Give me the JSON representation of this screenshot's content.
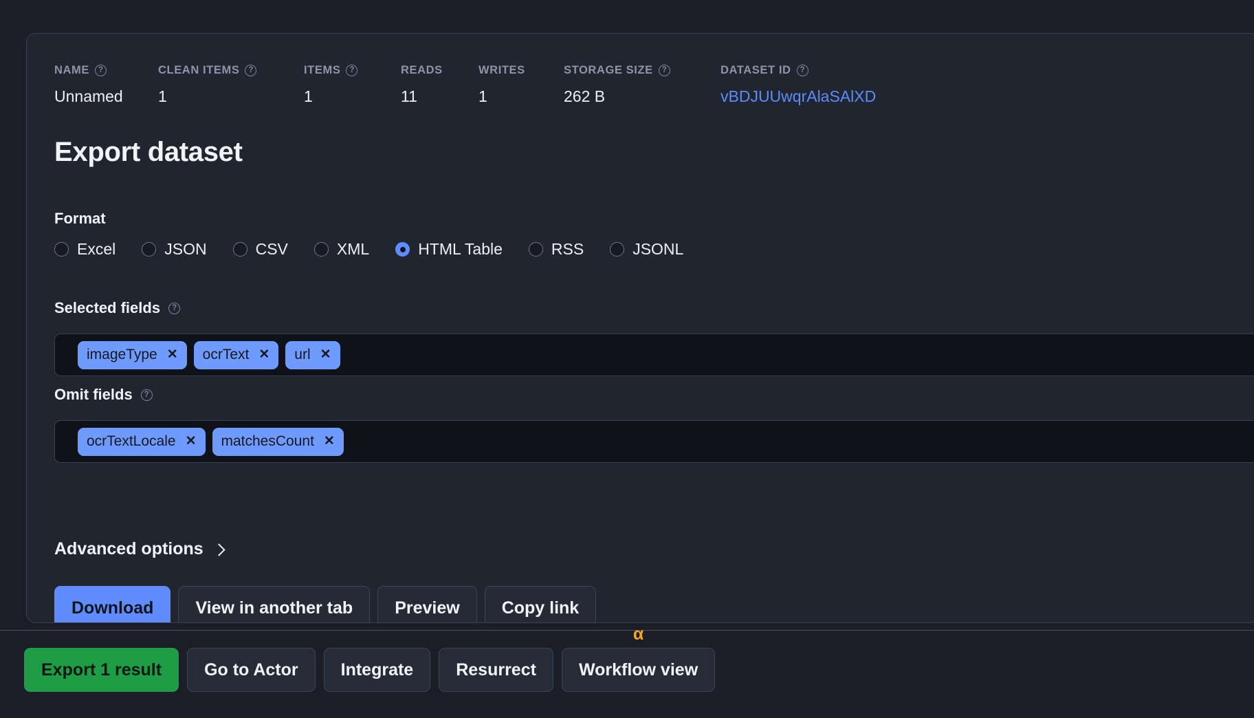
{
  "stats": [
    {
      "label": "NAME",
      "value": "Unnamed",
      "help": true,
      "width_class": "w-name",
      "link": false
    },
    {
      "label": "CLEAN ITEMS",
      "value": "1",
      "help": true,
      "width_class": "w-clean",
      "link": false
    },
    {
      "label": "ITEMS",
      "value": "1",
      "help": true,
      "width_class": "w-items",
      "link": false
    },
    {
      "label": "READS",
      "value": "11",
      "help": false,
      "width_class": "w-reads",
      "link": false
    },
    {
      "label": "WRITES",
      "value": "1",
      "help": false,
      "width_class": "w-writes",
      "link": false
    },
    {
      "label": "STORAGE SIZE",
      "value": "262 B",
      "help": true,
      "width_class": "w-size",
      "link": false
    },
    {
      "label": "DATASET ID",
      "value": "vBDJUUwqrAlaSAlXD",
      "help": true,
      "width_class": "w-id",
      "link": true
    }
  ],
  "page": {
    "title": "Export dataset"
  },
  "format": {
    "label": "Format",
    "options": [
      {
        "label": "Excel",
        "selected": false
      },
      {
        "label": "JSON",
        "selected": false
      },
      {
        "label": "CSV",
        "selected": false
      },
      {
        "label": "XML",
        "selected": false
      },
      {
        "label": "HTML Table",
        "selected": true
      },
      {
        "label": "RSS",
        "selected": false
      },
      {
        "label": "JSONL",
        "selected": false
      }
    ],
    "selected_value": "HTML Table"
  },
  "selected_fields": {
    "label": "Selected fields",
    "tokens": [
      "imageType",
      "ocrText",
      "url"
    ],
    "remove_glyph": "✕"
  },
  "omit_fields": {
    "label": "Omit fields",
    "tokens": [
      "ocrTextLocale",
      "matchesCount"
    ],
    "remove_glyph": "✕"
  },
  "advanced": {
    "label": "Advanced options",
    "expanded": false
  },
  "actions": [
    {
      "label": "Download",
      "style": "primary"
    },
    {
      "label": "View in another tab",
      "style": "ghost"
    },
    {
      "label": "Preview",
      "style": "ghost"
    },
    {
      "label": "Copy link",
      "style": "ghost"
    }
  ],
  "bottom_bar": {
    "buttons": [
      {
        "label": "Export 1 result",
        "style": "green",
        "badge": ""
      },
      {
        "label": "Go to Actor",
        "style": "dark",
        "badge": ""
      },
      {
        "label": "Integrate",
        "style": "dark",
        "badge": ""
      },
      {
        "label": "Resurrect",
        "style": "dark",
        "badge": ""
      },
      {
        "label": "Workflow view",
        "style": "dark",
        "badge": "α"
      }
    ]
  },
  "colors": {
    "page_bg": "#1b1e26",
    "card_bg": "#21252f",
    "card_border": "#3a4052",
    "accent_blue": "#5f8cff",
    "token_blue": "#6f9bff",
    "green": "#1f9d46",
    "alpha_orange": "#f5a623",
    "text_primary": "#f2f4f8",
    "text_muted": "#8e95a8",
    "input_bg": "#0f1218"
  },
  "icons": {
    "help": "?",
    "chevron_right": "›"
  }
}
